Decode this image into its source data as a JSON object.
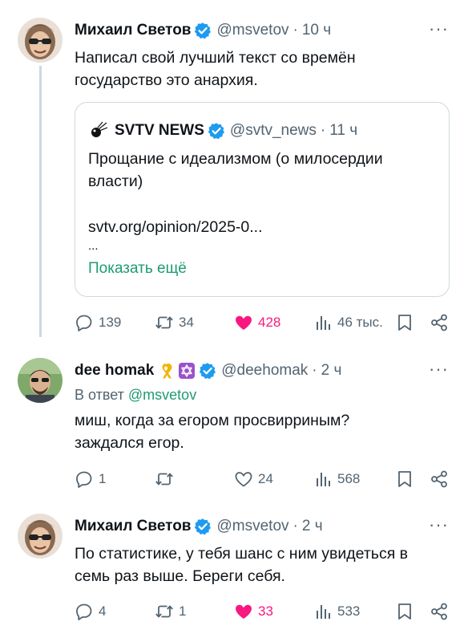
{
  "tweets": [
    {
      "author_name": "Михаил Светов",
      "handle": "@msvetov",
      "time": "10 ч",
      "text": [
        "Написал свой лучший текст со времён",
        "государство это анархия."
      ],
      "quote": {
        "author_name": "SVTV NEWS",
        "handle": "@svtv_news",
        "time": "11 ч",
        "text": [
          "Прощание с идеализмом (о милосердии",
          "власти)"
        ],
        "link": "svtv.org/opinion/2025-0...",
        "ellipsis": "...",
        "show_more": "Показать ещё"
      },
      "stats": {
        "replies": "139",
        "retweets": "34",
        "likes": "428",
        "views": "46 тыс."
      },
      "liked": true
    },
    {
      "author_name": "dee homak",
      "handle": "@deehomak",
      "time": "2 ч",
      "reply_prefix": "В ответ",
      "reply_handle": "@msvetov",
      "text": [
        "миш, когда за егором просвирриным?",
        "заждался егор."
      ],
      "stats": {
        "replies": "1",
        "retweets": "",
        "likes": "24",
        "views": "568"
      },
      "liked": false
    },
    {
      "author_name": "Михаил Светов",
      "handle": "@msvetov",
      "time": "2 ч",
      "text": [
        "По статистике, у тебя шанс с ним увидеться в",
        "семь раз выше. Береги себя."
      ],
      "stats": {
        "replies": "4",
        "retweets": "1",
        "likes": "33",
        "views": "533"
      },
      "liked": true
    }
  ],
  "more_icon": "···",
  "colors": {
    "text": "#0f1419",
    "muted": "#536471",
    "verified": "#1d9bf0",
    "like": "#f91880",
    "link": "#1d9b74",
    "border": "#cfd9de"
  },
  "icons": [
    "verified-icon",
    "reply-icon",
    "retweet-icon",
    "like-icon",
    "views-icon",
    "bookmark-icon",
    "share-icon",
    "more-icon",
    "ribbon-icon",
    "star-of-david-icon"
  ]
}
